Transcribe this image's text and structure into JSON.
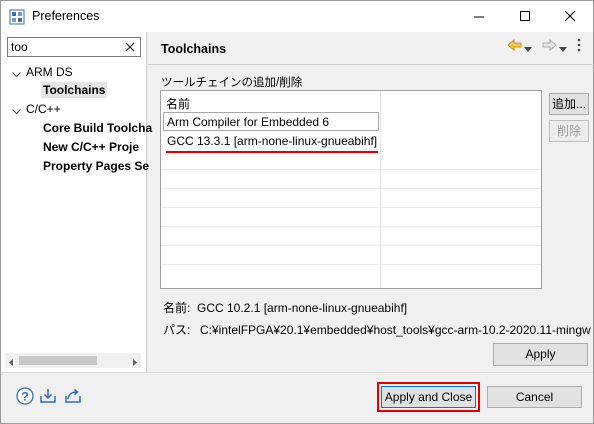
{
  "window": {
    "title": "Preferences"
  },
  "filter": {
    "value": "too"
  },
  "tree": {
    "items": [
      {
        "label": "ARM DS"
      },
      {
        "label": "Toolchains"
      },
      {
        "label": "C/C++"
      },
      {
        "label": "Core Build Toolcha"
      },
      {
        "label": "New C/C++ Proje"
      },
      {
        "label": "Property Pages Se"
      }
    ]
  },
  "page": {
    "title": "Toolchains",
    "section_label": "ツールチェインの追加/削除",
    "table": {
      "column_header": "名前",
      "rows": [
        {
          "name": "Arm Compiler for Embedded 6"
        },
        {
          "name": "GCC 13.3.1 [arm-none-linux-gnueabihf]"
        }
      ]
    },
    "add_button": "追加...",
    "remove_button": "削除",
    "details": {
      "name_key": "名前:",
      "name_value": "GCC 10.2.1 [arm-none-linux-gnueabihf]",
      "path_key": "パス:",
      "path_value": "C:¥intelFPGA¥20.1¥embedded¥host_tools¥gcc-arm-10.2-2020.11-mingw"
    },
    "apply_button": "Apply"
  },
  "footer": {
    "apply_close_button": "Apply and Close",
    "cancel_button": "Cancel"
  },
  "colors": {
    "highlight_red": "#e20000",
    "accent_blue": "#0078d7"
  },
  "icons": [
    "app-icon",
    "minimize-icon",
    "maximize-icon",
    "close-icon",
    "clear-filter-icon",
    "back-arrow-icon",
    "forward-arrow-icon",
    "view-menu-icon",
    "help-icon",
    "import-icon",
    "export-icon"
  ]
}
